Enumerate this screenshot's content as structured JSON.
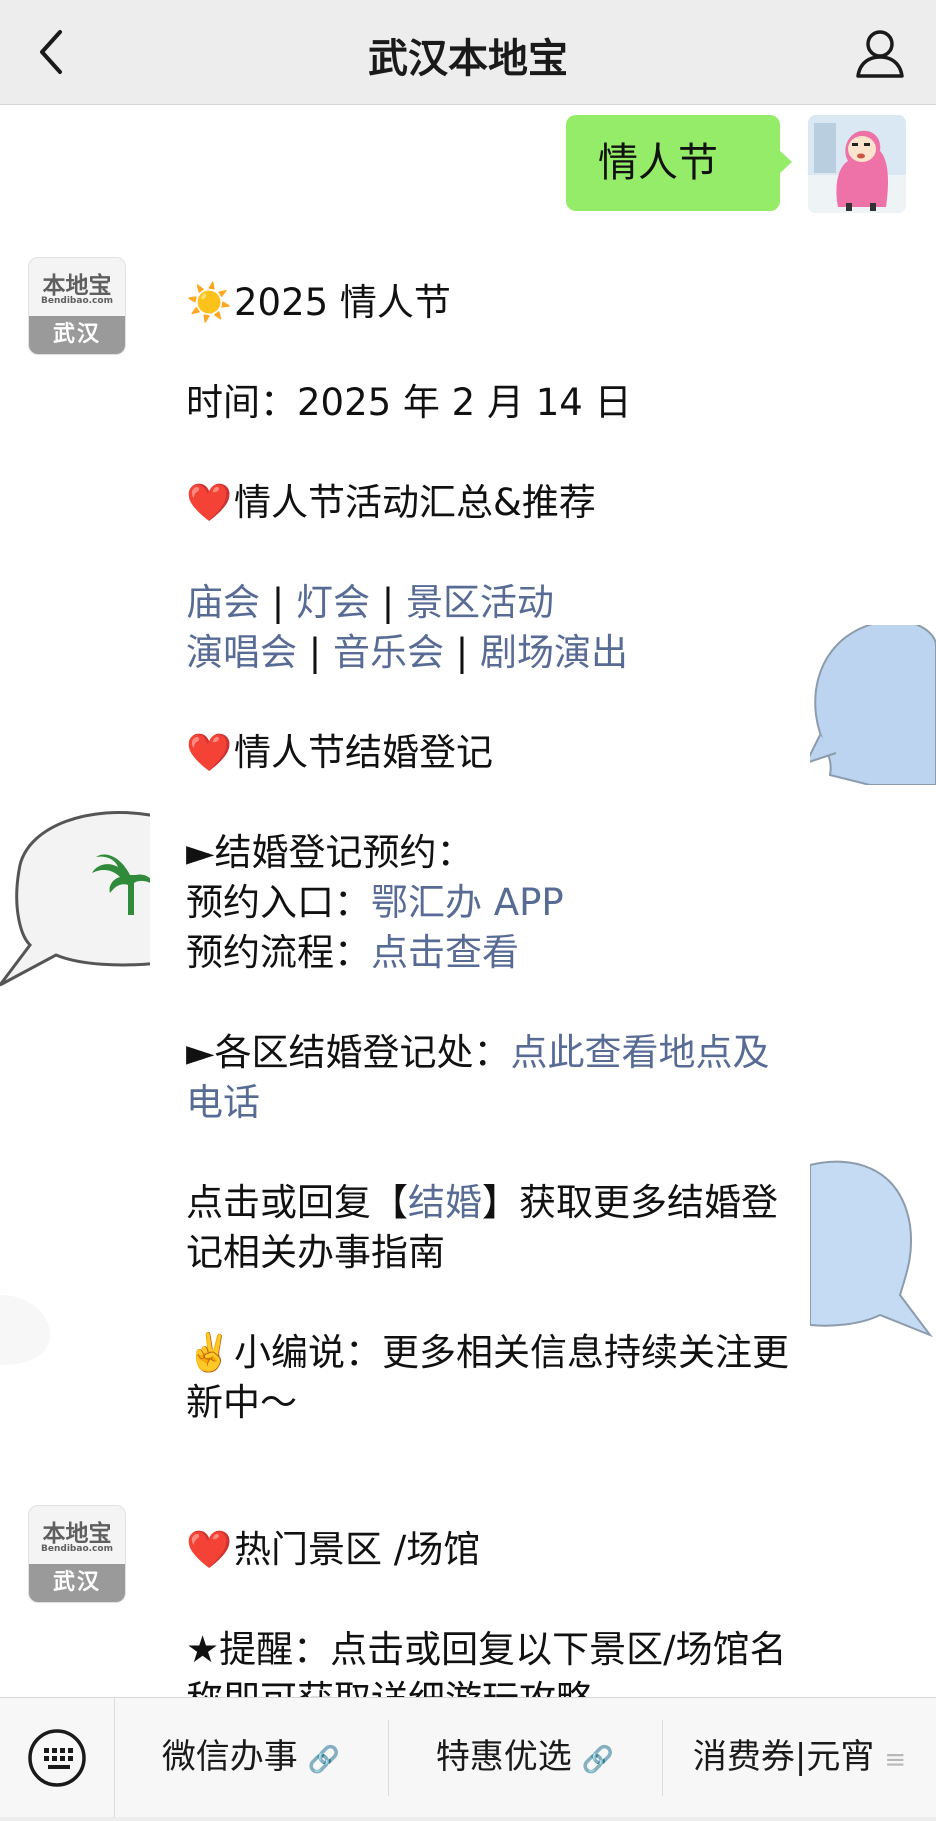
{
  "header": {
    "title": "武汉本地宝",
    "back_icon": "chevron-left-icon",
    "profile_icon": "person-icon"
  },
  "chat": {
    "user_message": "情人节",
    "bot_avatar": {
      "brand": "本地宝",
      "site": "Bendibao.com",
      "city": "武汉"
    },
    "msg1": {
      "title_emoji": "☀️",
      "title": "2025 情人节",
      "time_line": "时间：2025 年 2 月 14 日",
      "section1_emoji": "❤️",
      "section1_title": "情人节活动汇总&推荐",
      "links_row1": [
        "庙会",
        "灯会",
        "景区活动"
      ],
      "links_row2": [
        "演唱会",
        "音乐会",
        "剧场演出"
      ],
      "separator": " | ",
      "section2_emoji": "❤️",
      "section2_title": "情人节结婚登记",
      "booking_heading": "►结婚登记预约：",
      "booking_entry_label": "预约入口：",
      "booking_entry_link": "鄂汇办 APP",
      "booking_process_label": "预约流程：",
      "booking_process_link": "点击查看",
      "offices_label": "►各区结婚登记处：",
      "offices_link": "点此查看地点及电话",
      "reply_pre": "点击或回复【",
      "reply_link": "结婚",
      "reply_post": "】获取更多结婚登记相关办事指南",
      "editor_emoji": "✌️",
      "editor_note": "小编说：更多相关信息持续关注更新中～"
    },
    "msg2": {
      "section_emoji": "❤️",
      "section_title": "热门景区 /场馆",
      "reminder": "★提醒：点击或回复以下景区/场馆名称即可获取详细游玩攻略"
    }
  },
  "menu": {
    "keyboard_icon": "keyboard-icon",
    "items": [
      {
        "label": "微信办事",
        "icon": "link-icon"
      },
      {
        "label": "特惠优选",
        "icon": "link-icon"
      },
      {
        "label": "消费券|元宵",
        "icon": "menu-lines-icon"
      }
    ]
  },
  "colors": {
    "user_bubble": "#95ec69",
    "link": "#576b95",
    "header_bg": "#ededed",
    "chat_bg": "#ffffff"
  }
}
